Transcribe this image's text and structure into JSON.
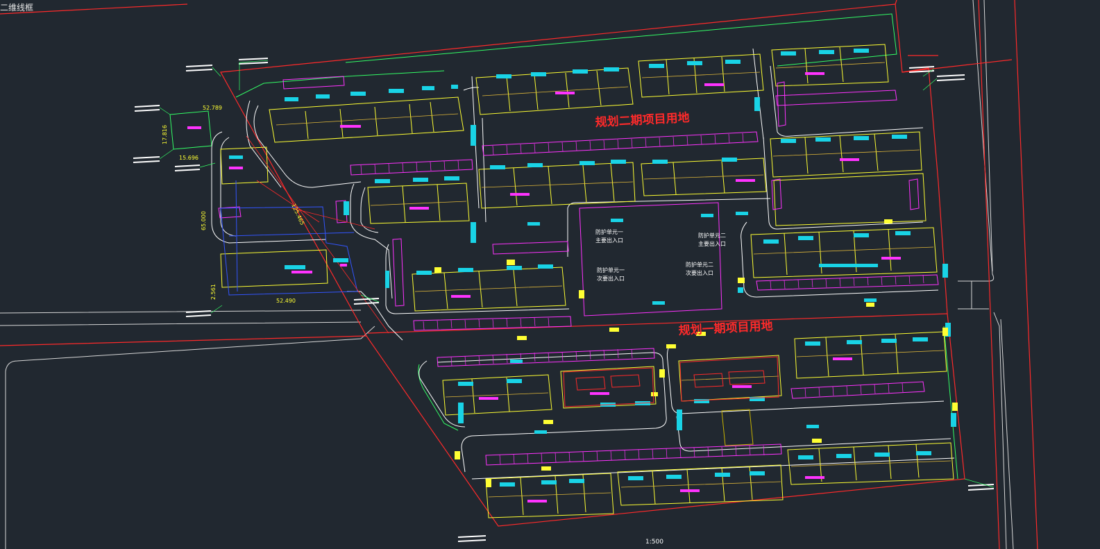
{
  "viewport": {
    "label": "二维线框"
  },
  "annotations": {
    "phase2_label": "规划二期项目用地",
    "phase1_label": "规划一期项目用地",
    "entrance_1": [
      "防护单元一",
      "主要出入口"
    ],
    "entrance_2": [
      "防护单元二",
      "主要出入口"
    ],
    "entrance_3": [
      "防护单元一",
      "次要出入口"
    ],
    "entrance_4": [
      "防护单元二",
      "次要出入口"
    ],
    "scale": "1:500"
  },
  "dimensions": [
    "52.789",
    "17.816",
    "15.696",
    "125.465",
    "65.000",
    "2.561",
    "52.490"
  ],
  "colors": {
    "background": "#212830",
    "boundary": "#ff2a2a",
    "building": "#ffff33",
    "road": "#ffffff",
    "parking": "#ff33ff",
    "cyan_labels": "#19d3e6",
    "green": "#33ff66",
    "blue": "#3355ff"
  }
}
